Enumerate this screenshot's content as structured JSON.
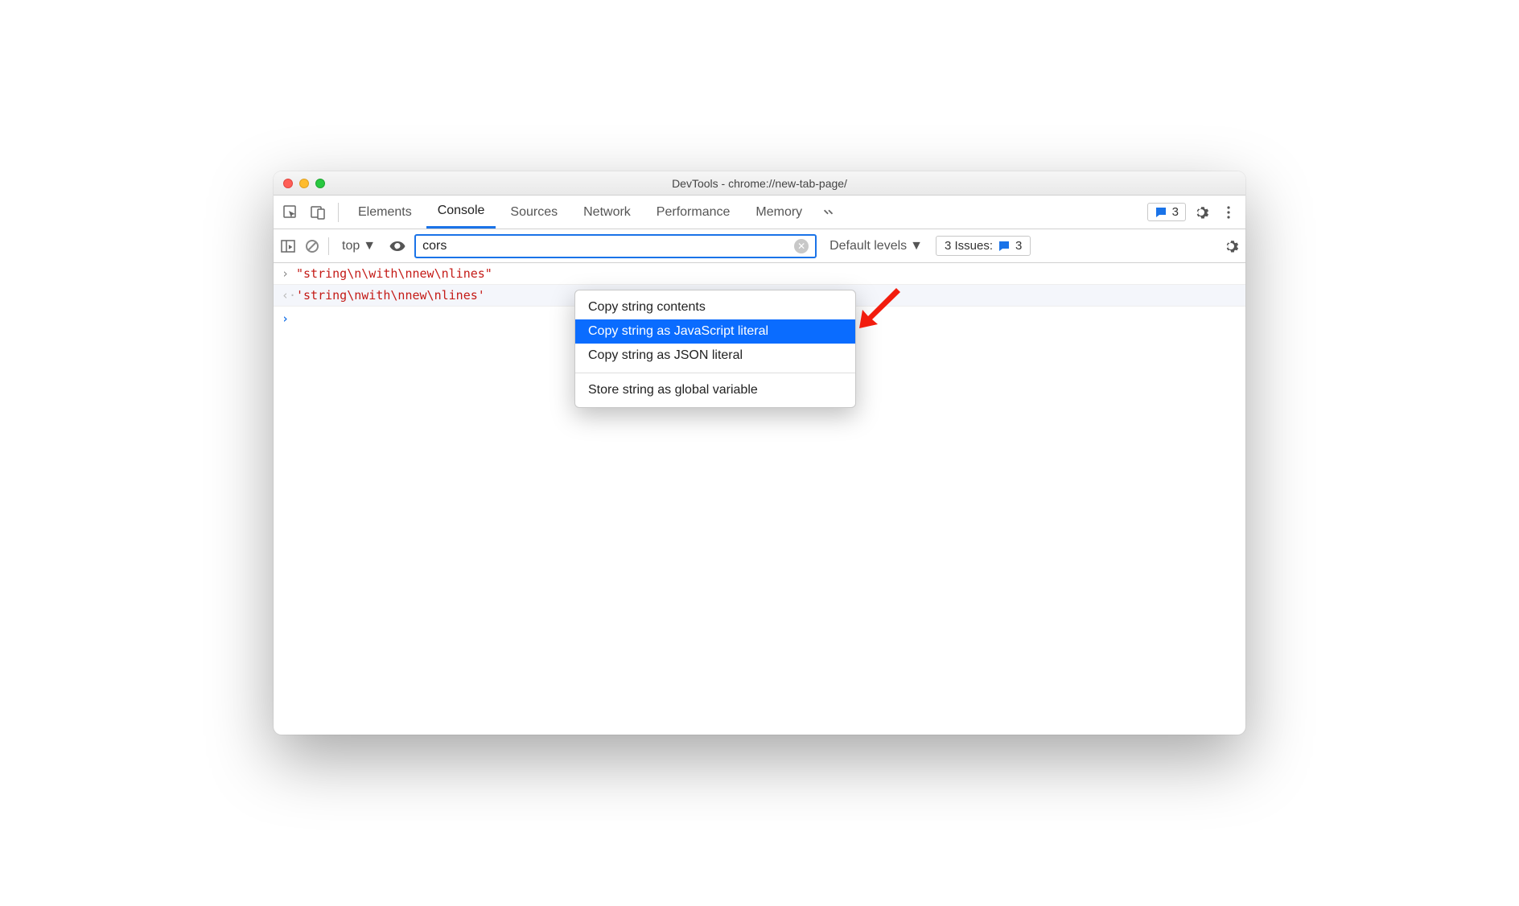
{
  "window": {
    "title": "DevTools - chrome://new-tab-page/"
  },
  "tabs": {
    "items": [
      "Elements",
      "Console",
      "Sources",
      "Network",
      "Performance",
      "Memory"
    ],
    "active": "Console",
    "badge_count": "3"
  },
  "console_toolbar": {
    "context": "top",
    "filter_value": "cors",
    "levels_label": "Default levels",
    "issues_label": "3 Issues:",
    "issues_count": "3"
  },
  "console_rows": {
    "input": "\"string\\n\\with\\nnew\\nlines\"",
    "output": "'string\\nwith\\nnew\\nlines'"
  },
  "context_menu": {
    "items": [
      "Copy string contents",
      "Copy string as JavaScript literal",
      "Copy string as JSON literal"
    ],
    "after_sep": [
      "Store string as global variable"
    ],
    "selected_index": 1
  }
}
